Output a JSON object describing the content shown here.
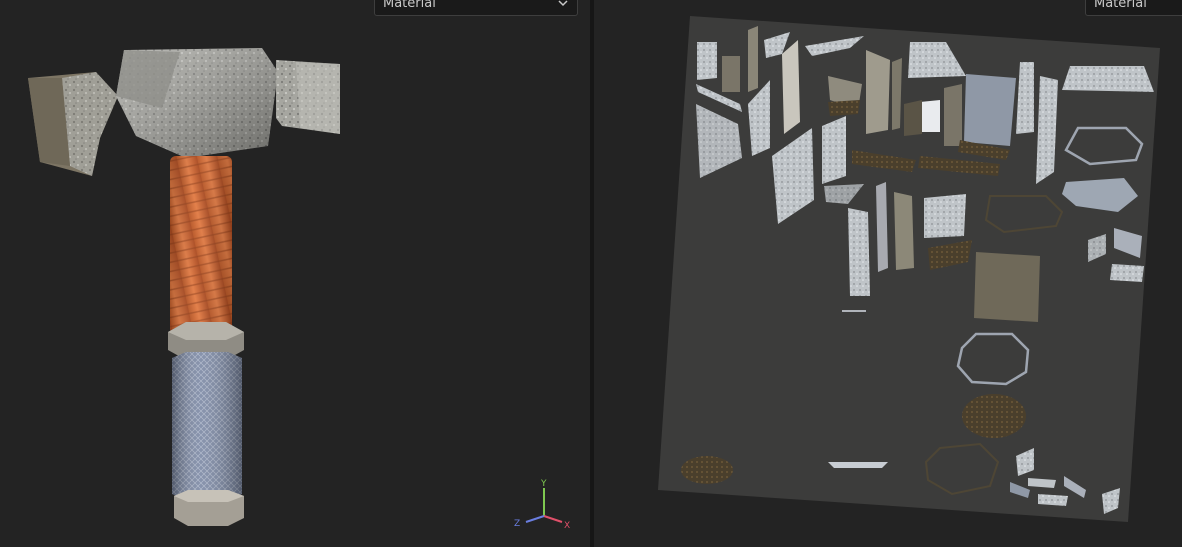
{
  "viewport_3d": {
    "material_dropdown": {
      "selected": "Material"
    },
    "axis_gizmo": {
      "x_label": "X",
      "y_label": "Y",
      "z_label": "Z"
    }
  },
  "viewport_2d": {
    "material_dropdown": {
      "selected": "Material"
    }
  },
  "colors": {
    "background": "#232323",
    "handle_wood": "#d06a34",
    "grip": "#7d8aa6",
    "metal": "#a9a9a4",
    "axis_x": "#e0506a",
    "axis_y": "#7ec850",
    "axis_z": "#6a7ee0"
  },
  "icons": [
    "chevron-down-icon",
    "axis-gizmo-icon"
  ]
}
